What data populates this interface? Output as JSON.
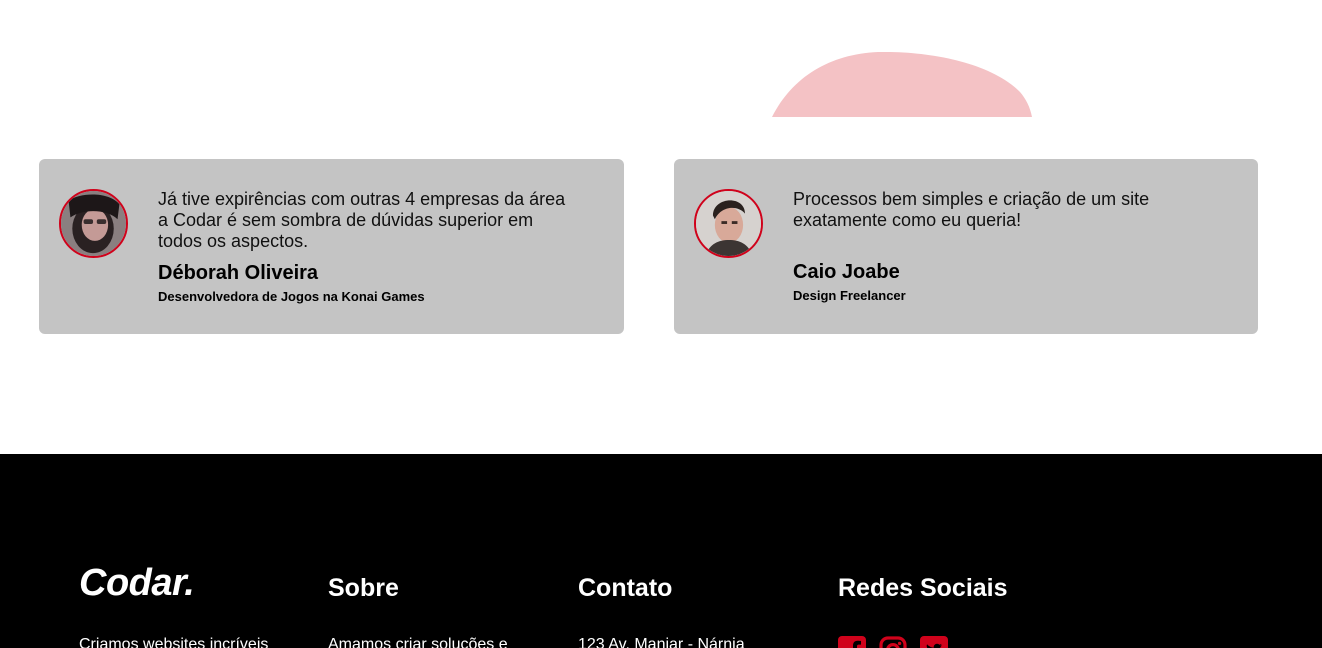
{
  "testimonials": [
    {
      "quote": "Já tive expirências com outras 4 empresas da área a Codar é sem sombra de dúvidas superior em todos os aspectos.",
      "name": "Déborah Oliveira",
      "role": "Desenvolvedora de Jogos na Konai Games"
    },
    {
      "quote": "Processos bem simples e criação de um site exatamente como eu queria!",
      "name": "Caio Joabe",
      "role": "Design Freelancer"
    }
  ],
  "footer": {
    "logo": "Codar.",
    "about_text": "Criamos websites incríveis",
    "sobre_title": "Sobre",
    "sobre_text": "Amamos criar soluções e",
    "contato_title": "Contato",
    "contato_text": "123 Av. Manjar - Nárnia",
    "redes_title": "Redes Sociais",
    "social_icons": [
      "facebook-icon",
      "instagram-icon",
      "twitter-icon"
    ]
  },
  "colors": {
    "accent": "#d0021b",
    "blob": "#f4c2c5",
    "card": "#c4c4c4",
    "footer": "#000000"
  }
}
